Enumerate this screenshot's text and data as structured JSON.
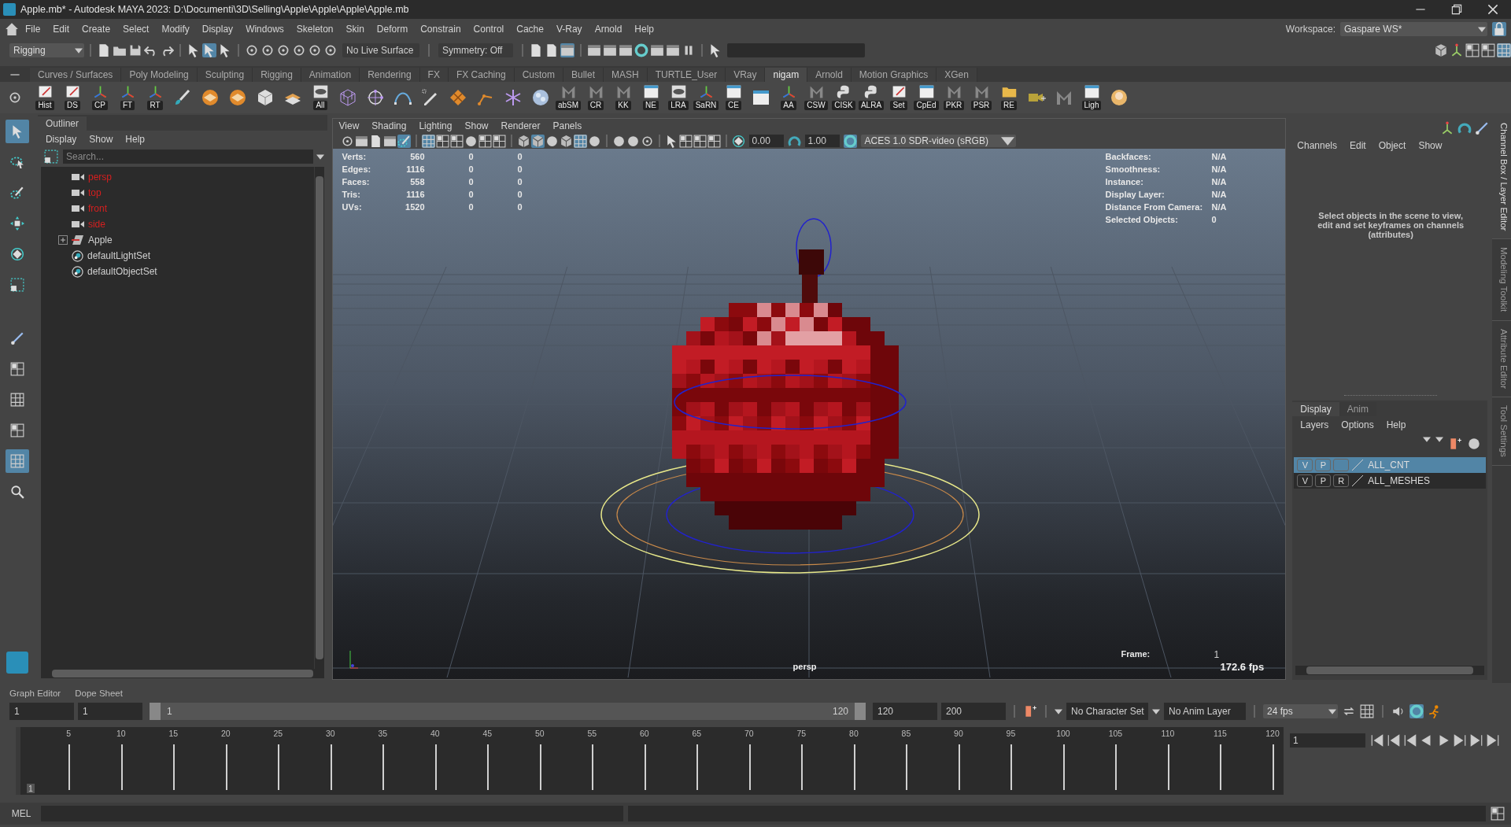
{
  "window": {
    "title": "Apple.mb* - Autodesk MAYA 2023: D:\\Documenti\\3D\\Selling\\Apple\\Apple\\Apple\\Apple.mb"
  },
  "menu_bar": [
    "File",
    "Edit",
    "Create",
    "Select",
    "Modify",
    "Display",
    "Windows",
    "Skeleton",
    "Skin",
    "Deform",
    "Constrain",
    "Control",
    "Cache",
    "V-Ray",
    "Arnold",
    "Help"
  ],
  "workspace": {
    "label": "Workspace:",
    "value": "Gaspare WS*"
  },
  "status_line": {
    "menu_set": "Rigging",
    "live_surface": "No Live Surface",
    "symmetry": "Symmetry: Off"
  },
  "shelf": {
    "tabs": [
      {
        "label": "Curves / Surfaces",
        "selected": false
      },
      {
        "label": "Poly Modeling",
        "selected": false
      },
      {
        "label": "Sculpting",
        "selected": false
      },
      {
        "label": "Rigging",
        "selected": false
      },
      {
        "label": "Animation",
        "selected": false
      },
      {
        "label": "Rendering",
        "selected": false
      },
      {
        "label": "FX",
        "selected": false
      },
      {
        "label": "FX Caching",
        "selected": false
      },
      {
        "label": "Custom",
        "selected": false
      },
      {
        "label": "Bullet",
        "selected": false
      },
      {
        "label": "MASH",
        "selected": false
      },
      {
        "label": "TURTLE_User",
        "selected": false
      },
      {
        "label": "VRay",
        "selected": false
      },
      {
        "label": "nigam",
        "selected": true
      },
      {
        "label": "Arnold",
        "selected": false
      },
      {
        "label": "Motion Graphics",
        "selected": false
      },
      {
        "label": "XGen",
        "selected": false
      }
    ],
    "buttons": [
      {
        "kind": "labeled",
        "label": "Hist"
      },
      {
        "kind": "labeled",
        "label": "DS"
      },
      {
        "kind": "labeled",
        "label": "CP"
      },
      {
        "kind": "labeled",
        "label": "FT"
      },
      {
        "kind": "labeled",
        "label": "RT"
      },
      {
        "kind": "plain"
      },
      {
        "kind": "plain"
      },
      {
        "kind": "plain"
      },
      {
        "kind": "plain"
      },
      {
        "kind": "plain"
      },
      {
        "kind": "labeled",
        "label": "All"
      },
      {
        "kind": "plain"
      },
      {
        "kind": "plain"
      },
      {
        "kind": "plain"
      },
      {
        "kind": "plain"
      },
      {
        "kind": "plain"
      },
      {
        "kind": "plain"
      },
      {
        "kind": "plain"
      },
      {
        "kind": "plain"
      },
      {
        "kind": "labeled",
        "label": "abSM"
      },
      {
        "kind": "labeled",
        "label": "CR"
      },
      {
        "kind": "labeled",
        "label": "KK"
      },
      {
        "kind": "labeled",
        "label": "NE"
      },
      {
        "kind": "labeled",
        "label": "LRA"
      },
      {
        "kind": "labeled",
        "label": "SaRN"
      },
      {
        "kind": "labeled",
        "label": "CE"
      },
      {
        "kind": "plain"
      },
      {
        "kind": "labeled",
        "label": "AA"
      },
      {
        "kind": "labeled",
        "label": "CSW"
      },
      {
        "kind": "labeled",
        "label": "CISK"
      },
      {
        "kind": "labeled",
        "label": "ALRA"
      },
      {
        "kind": "labeled",
        "label": "Set"
      },
      {
        "kind": "labeled",
        "label": "CpEd"
      },
      {
        "kind": "labeled",
        "label": "PKR"
      },
      {
        "kind": "labeled",
        "label": "PSR"
      },
      {
        "kind": "labeled",
        "label": "RE"
      },
      {
        "kind": "plain"
      },
      {
        "kind": "plain"
      },
      {
        "kind": "labeled",
        "label": "Ligh"
      },
      {
        "kind": "plain"
      }
    ]
  },
  "outliner": {
    "title": "Outliner",
    "menu": [
      "Display",
      "Show",
      "Help"
    ],
    "search": {
      "placeholder": "Search..."
    },
    "items": [
      {
        "kind": "camera",
        "label": "persp",
        "color": "#d61f1f"
      },
      {
        "kind": "camera",
        "label": "top",
        "color": "#d61f1f"
      },
      {
        "kind": "camera",
        "label": "front",
        "color": "#d61f1f"
      },
      {
        "kind": "camera",
        "label": "side",
        "color": "#d61f1f"
      },
      {
        "kind": "group",
        "label": "Apple",
        "expanded": false
      },
      {
        "kind": "set",
        "label": "defaultLightSet"
      },
      {
        "kind": "set",
        "label": "defaultObjectSet"
      }
    ]
  },
  "viewport": {
    "menu": [
      "View",
      "Shading",
      "Lighting",
      "Show",
      "Renderer",
      "Panels"
    ],
    "exposure": "0.00",
    "gamma": "1.00",
    "color_space": "ACES 1.0 SDR-video (sRGB)",
    "hud_left": [
      {
        "label": "Verts:",
        "values": [
          "560",
          "0",
          "0"
        ]
      },
      {
        "label": "Edges:",
        "values": [
          "1116",
          "0",
          "0"
        ]
      },
      {
        "label": "Faces:",
        "values": [
          "558",
          "0",
          "0"
        ]
      },
      {
        "label": "Tris:",
        "values": [
          "1116",
          "0",
          "0"
        ]
      },
      {
        "label": "UVs:",
        "values": [
          "1520",
          "0",
          "0"
        ]
      }
    ],
    "hud_right": [
      {
        "label": "Backfaces:",
        "value": "N/A"
      },
      {
        "label": "Smoothness:",
        "value": "N/A"
      },
      {
        "label": "Instance:",
        "value": "N/A"
      },
      {
        "label": "Display Layer:",
        "value": "N/A"
      },
      {
        "label": "Distance From Camera:",
        "value": "N/A"
      },
      {
        "label": "Selected Objects:",
        "value": "0"
      }
    ],
    "camera": "persp",
    "frame_label": "Frame:",
    "frame": "1",
    "fps": "172.6 fps"
  },
  "channel_box": {
    "menu": [
      "Channels",
      "Edit",
      "Object",
      "Show"
    ],
    "message": "Select objects in the scene to view, edit and set keyframes on channels (attributes)"
  },
  "layer_editor": {
    "tabs": [
      {
        "label": "Display",
        "selected": true
      },
      {
        "label": "Anim",
        "selected": false
      }
    ],
    "menu": [
      "Layers",
      "Options",
      "Help"
    ],
    "layers": [
      {
        "flags": [
          "V",
          "P"
        ],
        "name": "ALL_CNT",
        "selected": true
      },
      {
        "flags": [
          "V",
          "P",
          "R"
        ],
        "name": "ALL_MESHES",
        "selected": false
      }
    ]
  },
  "side_tabs": [
    {
      "label": "Channel Box / Layer Editor",
      "selected": true
    },
    {
      "label": "Modeling Toolkit",
      "selected": false
    },
    {
      "label": "Attribute Editor",
      "selected": false
    },
    {
      "label": "Tool Settings",
      "selected": false
    }
  ],
  "time_editor_tabs": [
    "Graph Editor",
    "Dope Sheet"
  ],
  "range": {
    "start": "1",
    "playback_start": "1",
    "slider_start": "1",
    "slider_end": "120",
    "playback_end": "120",
    "end": "200",
    "level": 1
  },
  "time_slider": {
    "level": 0,
    "ticks": [
      "5",
      "10",
      "15",
      "20",
      "25",
      "30",
      "35",
      "40",
      "45",
      "50",
      "55",
      "60",
      "65",
      "70",
      "75",
      "80",
      "85",
      "90",
      "95",
      "100",
      "105",
      "110",
      "115",
      "120"
    ],
    "current": "1"
  },
  "current_frame": "1",
  "character_set": "No Character Set",
  "anim_layer": "No Anim Layer",
  "fps": "24 fps",
  "command_line": {
    "label": "MEL"
  }
}
